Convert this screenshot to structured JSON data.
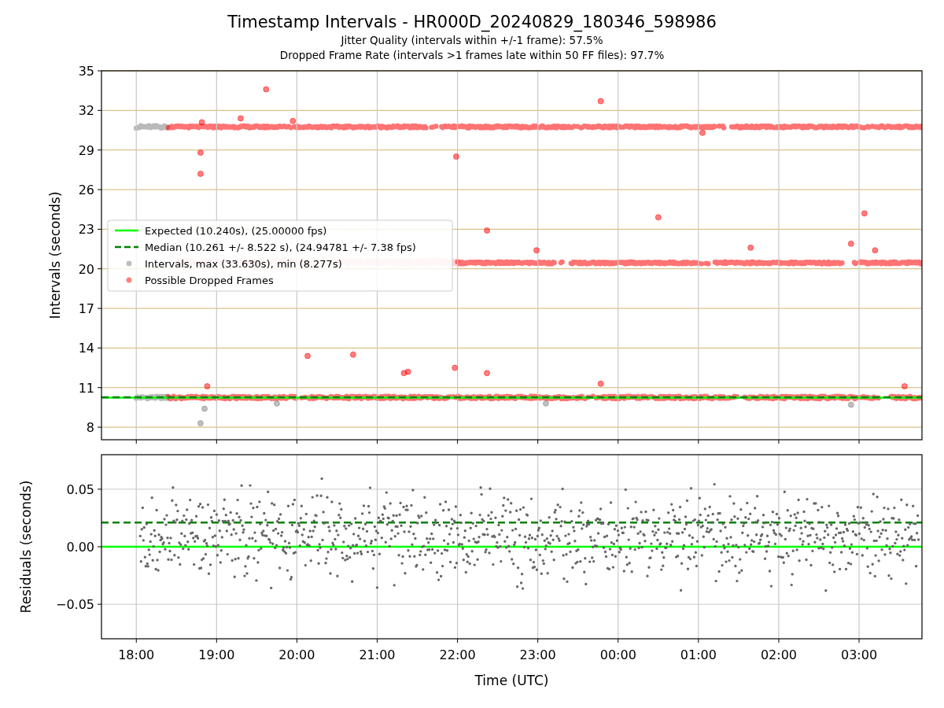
{
  "title": "Timestamp Intervals - HR000D_20240829_180346_598986",
  "subtitles": [
    "Jitter Quality (intervals within +/-1 frame): 57.5%",
    "Dropped Frame Rate (intervals >1 frames late within 50 FF files): 97.7%"
  ],
  "intervals_plot": {
    "chart_data": {
      "type": "scatter",
      "ylabel": "Intervals (seconds)",
      "xlim": [
        "2024-08-29T17:34",
        "2024-08-30T03:47"
      ],
      "ylim": [
        7.05,
        35
      ],
      "grid": true,
      "legend": true,
      "yticks": [
        {
          "value": 8,
          "label": "8"
        },
        {
          "value": 11,
          "label": "11"
        },
        {
          "value": 14,
          "label": "14"
        },
        {
          "value": 17,
          "label": "17"
        },
        {
          "value": 20,
          "label": "20"
        },
        {
          "value": 23,
          "label": "23"
        },
        {
          "value": 26,
          "label": "26"
        },
        {
          "value": 29,
          "label": "29"
        },
        {
          "value": 32,
          "label": "32"
        },
        {
          "value": 35,
          "label": "35"
        }
      ],
      "ref_lines": [
        {
          "axis": "y",
          "value": 10.24,
          "label": "Expected (10.240s), (25.00000 fps)",
          "color": "#00ff00"
        },
        {
          "axis": "y",
          "value": 10.261,
          "label": "Median (10.261 +/- 8.522 s), (24.94781 +/- 7.38 fps)",
          "color": "#008000"
        }
      ],
      "series": [
        {
          "name": "Intervals, max (33.630s), min (8.277s)",
          "color": "#808080",
          "x": [
            "2024-08-29T18:48",
            "2024-08-29T18:51",
            "2024-08-29T19:45",
            "2024-08-29T23:06",
            "2024-08-30T02:54"
          ],
          "values": [
            8.3,
            9.4,
            9.8,
            9.8,
            9.7
          ]
        },
        {
          "name": "Possible Dropped Frames",
          "color": "#ff0000",
          "x": [
            "2024-08-29T18:49",
            "2024-08-29T18:48",
            "2024-08-29T18:48",
            "2024-08-29T19:18",
            "2024-08-29T19:37",
            "2024-08-29T19:57",
            "2024-08-29T18:53",
            "2024-08-29T20:08",
            "2024-08-29T20:42",
            "2024-08-29T21:20",
            "2024-08-29T21:23",
            "2024-08-29T21:58",
            "2024-08-29T21:59",
            "2024-08-29T22:22",
            "2024-08-29T22:22",
            "2024-08-29T22:59",
            "2024-08-29T23:47",
            "2024-08-29T23:47",
            "2024-08-30T00:30",
            "2024-08-30T01:03",
            "2024-08-30T01:39",
            "2024-08-30T02:54",
            "2024-08-30T03:04",
            "2024-08-30T03:12",
            "2024-08-30T03:34"
          ],
          "values": [
            31.1,
            28.8,
            27.2,
            31.4,
            33.6,
            31.2,
            11.1,
            13.4,
            13.5,
            12.1,
            12.2,
            12.5,
            28.5,
            22.9,
            12.1,
            21.4,
            32.7,
            11.3,
            23.9,
            30.3,
            21.6,
            21.9,
            24.2,
            21.4,
            11.1
          ]
        }
      ]
    }
  },
  "residuals_plot": {
    "chart_data": {
      "type": "scatter",
      "xlabel": "Time (UTC)",
      "ylabel": "Residuals (seconds)",
      "xlim": [
        "2024-08-29T17:34",
        "2024-08-30T03:47"
      ],
      "ylim": [
        -0.08,
        0.08
      ],
      "grid": true,
      "xticks": [
        {
          "value": "2024-08-29T18:00",
          "label": "18:00"
        },
        {
          "value": "2024-08-29T19:00",
          "label": "19:00"
        },
        {
          "value": "2024-08-29T20:00",
          "label": "20:00"
        },
        {
          "value": "2024-08-29T21:00",
          "label": "21:00"
        },
        {
          "value": "2024-08-29T22:00",
          "label": "22:00"
        },
        {
          "value": "2024-08-29T23:00",
          "label": "23:00"
        },
        {
          "value": "2024-08-30T00:00",
          "label": "00:00"
        },
        {
          "value": "2024-08-30T01:00",
          "label": "01:00"
        },
        {
          "value": "2024-08-30T02:00",
          "label": "02:00"
        },
        {
          "value": "2024-08-30T03:00",
          "label": "03:00"
        }
      ],
      "yticks": [
        {
          "value": 0.05,
          "label": "0.05"
        },
        {
          "value": 0,
          "label": "0.00"
        },
        {
          "value": -0.05,
          "label": "−0.05"
        }
      ],
      "ref_lines": [
        {
          "axis": "y",
          "value": 0,
          "color": "#00ff00"
        },
        {
          "axis": "y",
          "value": 0.021,
          "color": "#008000"
        }
      ]
    }
  }
}
